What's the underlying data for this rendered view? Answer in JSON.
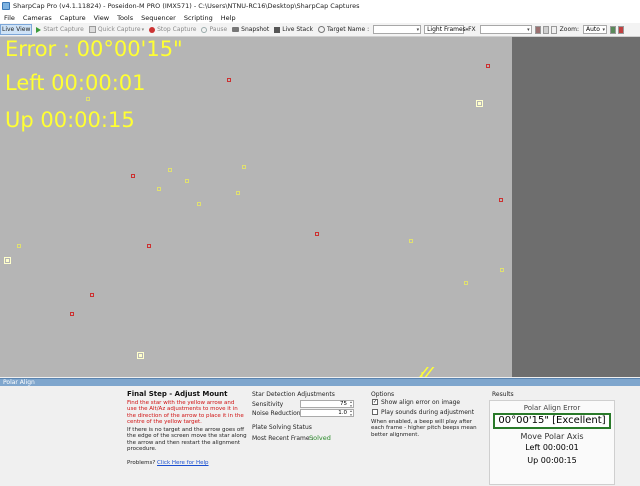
{
  "window": {
    "title": "SharpCap Pro (v4.1.11824) - Poseidon-M PRO (IMX571) - C:\\Users\\NTNU-RC16\\Desktop\\SharpCap Captures"
  },
  "menu": [
    "File",
    "Cameras",
    "Capture",
    "View",
    "Tools",
    "Sequencer",
    "Scripting",
    "Help"
  ],
  "toolbar": {
    "live_view": "Live View",
    "start_capture": "Start Capture",
    "quick_capture": "Quick Capture",
    "stop_capture": "Stop Capture",
    "pause": "Pause",
    "snapshot": "Snapshot",
    "live_stack": "Live Stack",
    "target_name_label": "Target Name :",
    "frame_type": "Light Frames",
    "fx_label": "FX",
    "zoom_label": "Zoom:",
    "zoom_value": "Auto"
  },
  "overlay": {
    "error": "Error : 00°00'15\"",
    "left": "Left 00:00:01",
    "up": "Up 00:00:15"
  },
  "colors": {
    "overlay_text": "#ffff33",
    "star_red": "#cc3030",
    "star_yellow": "#e0e070",
    "panel_header": "#7fa6cd",
    "result_border": "#2a7a2a",
    "solved_green": "#2a8a2a",
    "instruction_red": "#d01010"
  },
  "panel": {
    "header": "Polar Align",
    "step_title": "Final Step - Adjust Mount",
    "instructions_red": "Find the star with the yellow arrow and use the Alt/Az adjustments to move it in the direction of the arrow to place it in the centre of the yellow target.",
    "instructions_black": "If there is no target and the arrow goes off the edge of the screen move the star along the arrow and then restart the alignment procedure.",
    "problems_label": "Problems?",
    "help_link": "Click Here for Help",
    "star_detection": {
      "title": "Star Detection Adjustments",
      "sensitivity_label": "Sensitivity",
      "sensitivity_value": "75",
      "noise_label": "Noise Reduction",
      "noise_value": "1.0"
    },
    "plate_solving": {
      "title": "Plate Solving Status",
      "recent_label": "Most Recent Frame :",
      "recent_value": "Solved"
    },
    "options": {
      "title": "Options",
      "show_align_error": "Show align error on image",
      "show_align_error_checked": true,
      "play_sounds": "Play sounds during adjustment",
      "play_sounds_checked": false,
      "note": "When enabled, a beep will play after each frame - higher pitch beeps mean better alignment."
    },
    "results": {
      "title": "Results",
      "polar_align_error_label": "Polar Align Error",
      "polar_align_error_value": "00°00'15\" [Excellent]",
      "move_label": "Move Polar Axis",
      "left": "Left 00:00:01",
      "up": "Up 00:00:15"
    }
  }
}
